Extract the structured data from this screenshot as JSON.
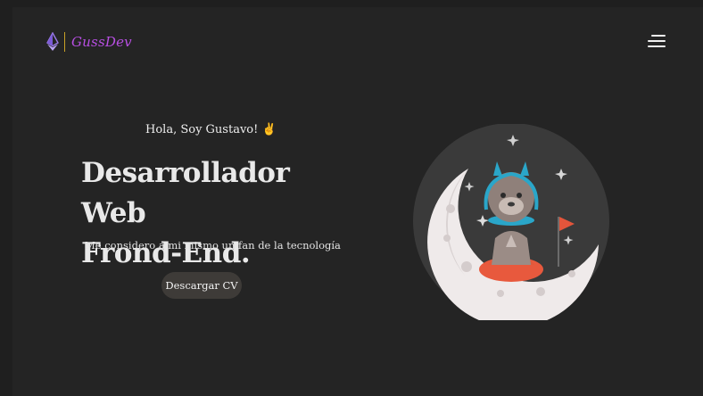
{
  "header": {
    "logo_text": "GussDev",
    "logo_icon": "ethereum-icon",
    "menu_icon": "hamburger-menu-icon"
  },
  "hero": {
    "greeting": "Hola, Soy Gustavo! ✌️",
    "title_line1": "Desarrollador Web",
    "title_line2": "Frond-End.",
    "subtitle": "Me considero a mi mismo un fan de la tecnología",
    "cta_label": "Descargar CV"
  },
  "illustration": {
    "description_icon": "astronaut-llama-moon-icon"
  },
  "colors": {
    "background": "#242424",
    "outer_background": "#1f1f1f",
    "logo_text": "#b84fe3",
    "logo_separator": "#c9a227",
    "button_bg": "#3e3b38",
    "text": "#e9e9e9"
  }
}
